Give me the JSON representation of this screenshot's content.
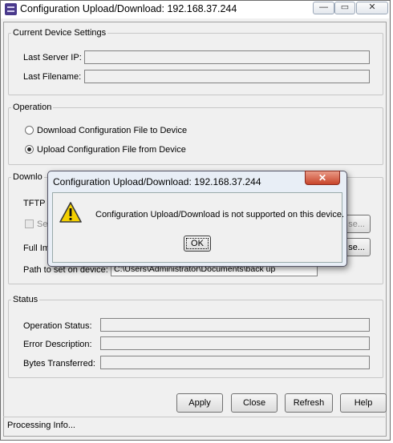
{
  "window": {
    "title": "Configuration Upload/Download: 192.168.37.244",
    "minimize_glyph": "—",
    "maximize_glyph": "▭",
    "close_glyph": "✕"
  },
  "current_device_settings": {
    "legend": "Current Device Settings",
    "last_server_ip_label": "Last Server IP:",
    "last_server_ip_value": "",
    "last_filename_label": "Last Filename:",
    "last_filename_value": ""
  },
  "operation": {
    "legend": "Operation",
    "download_label": "Download Configuration File to Device",
    "upload_label": "Upload Configuration File from Device",
    "selected": "upload"
  },
  "download_section": {
    "legend_visible": "Downlo",
    "tftp_visible": "TFTP S",
    "checkbox_visible": "Se",
    "browse1_visible": "se...",
    "full_im_visible": "Full Im",
    "browse2_visible": "se...",
    "path_label": "Path to set on device:",
    "path_value": "C:\\Users\\Administrator\\Documents\\back up"
  },
  "status": {
    "legend": "Status",
    "operation_status_label": "Operation Status:",
    "operation_status_value": "",
    "error_description_label": "Error Description:",
    "error_description_value": "",
    "bytes_transferred_label": "Bytes Transferred:",
    "bytes_transferred_value": ""
  },
  "buttons": {
    "apply": "Apply",
    "close": "Close",
    "refresh": "Refresh",
    "help": "Help"
  },
  "status_bar": {
    "text": "Processing Info..."
  },
  "dialog": {
    "title": "Configuration Upload/Download: 192.168.37.244",
    "message": "Configuration Upload/Download is not supported on this device.",
    "ok": "OK",
    "close_glyph": "✕",
    "icon": "warning-icon"
  }
}
